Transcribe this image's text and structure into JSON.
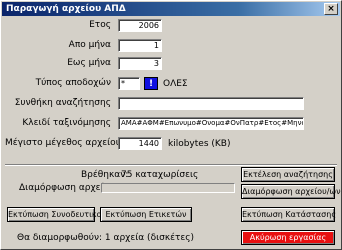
{
  "window": {
    "title": "Παραγωγή αρχείου ΑΠΔ",
    "close_symbol": "×"
  },
  "form": {
    "year_label": "Ετος",
    "year_value": "2006",
    "from_month_label": "Απο μήνα",
    "from_month_value": "1",
    "to_month_label": "Εως μήνα",
    "to_month_value": "3",
    "earnings_type_label": "Τύπος αποδοχών",
    "earnings_type_value": "*",
    "earnings_type_info": "!",
    "earnings_type_desc": "ΟΛΕΣ",
    "search_condition_label": "Συνθήκη αναζήτησης",
    "search_condition_value": "",
    "sort_key_label": "Κλειδί ταξινόμησης",
    "sort_key_value": "ΑΜΑ#ΑΦΜ#Επωνυμο#Ονομα#ΟνΠατρ#Ετος#Μηνας#ΤυπΑ",
    "max_size_label": "Μέγιστο μέγεθος αρχείου",
    "max_size_value": "1440",
    "max_size_unit": "kilobytes (KB)"
  },
  "status": {
    "found_label": "Βρέθηκαν:",
    "found_value": "75 καταχωρίσεις",
    "format_label": "Διαμόρφωση αρχείου",
    "progress": 0,
    "footer_text": "Θα διαμορφωθούν: 1 αρχεία (δισκέτες)"
  },
  "buttons": {
    "run_search": "Εκτέλεση αναζήτησης",
    "format_files": "Διαμόρφωση αρχείου/ων",
    "print_accompanying": "Εκτύπωση Συνοδευτικού",
    "print_labels": "Εκτύπωση Ετικετών",
    "print_status": "Εκτύπωση Κατάστασης",
    "cancel": "Ακύρωση εργασίας"
  },
  "colors": {
    "title_start": "#0a246a",
    "cancel_bg": "#e81010",
    "info_bg": "#1010e0"
  }
}
